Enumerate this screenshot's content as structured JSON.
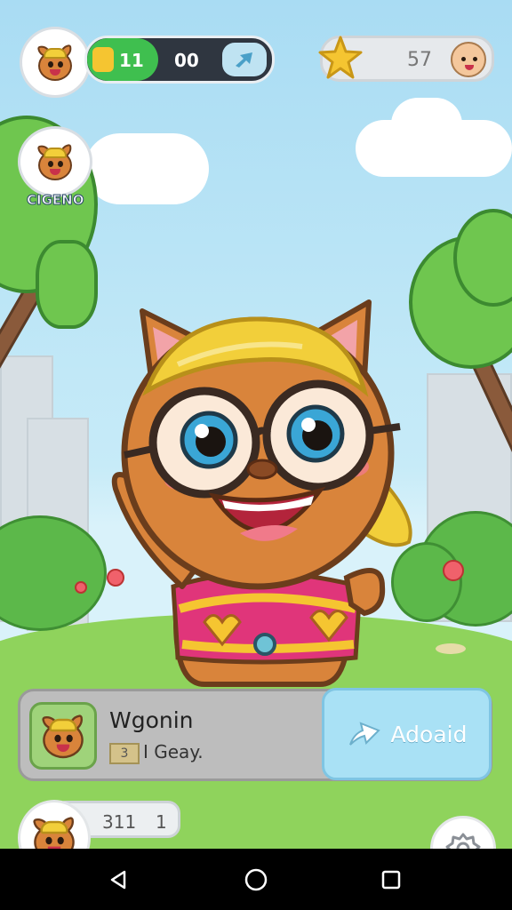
{
  "hud": {
    "player_bar_value": "11",
    "player_bar_count": "00",
    "stars_count": "57",
    "friend_label": "CIGENO"
  },
  "card": {
    "title": "Wgonin",
    "chip_text": "3",
    "subtitle": "I Geay.",
    "action_label": "Adoaid"
  },
  "footer": {
    "counter_left": "311",
    "counter_right": "1"
  },
  "colors": {
    "sky": "#a9dcf3",
    "grass": "#8fd35c",
    "energy_green": "#3fbf4f",
    "action_blue": "#a9e1f5"
  },
  "icons": {
    "energy": "lightning-icon",
    "share": "share-arrow-icon",
    "star": "star-icon",
    "action": "send-arrow-icon",
    "gear": "gear-icon",
    "back": "back-triangle-icon",
    "home": "home-circle-icon",
    "recents": "recents-square-icon"
  }
}
